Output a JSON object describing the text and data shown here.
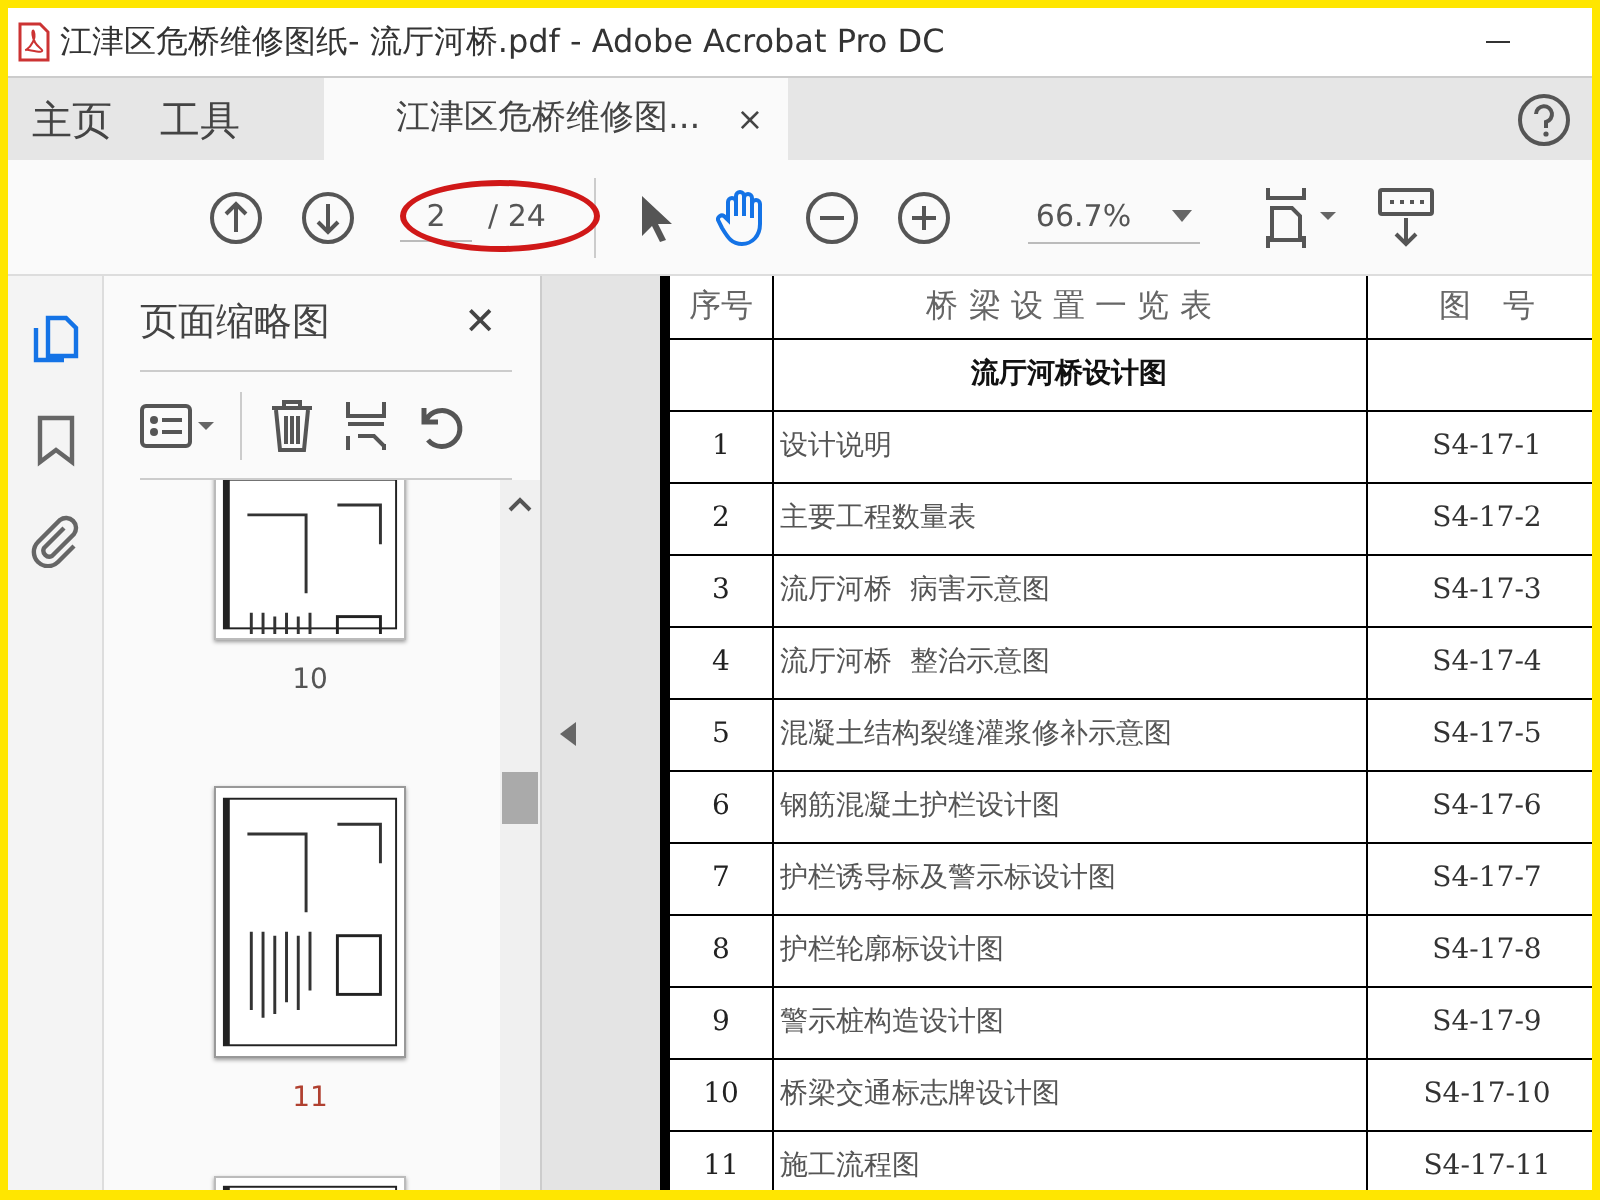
{
  "window": {
    "title": "江津区危桥维修图纸- 流厅河桥.pdf - Adobe Acrobat Pro DC"
  },
  "tabs": [
    {
      "label": "主页",
      "selected": false
    },
    {
      "label": "工具",
      "selected": false
    },
    {
      "label": "江津区危桥维修图...",
      "selected": true,
      "close": "×"
    }
  ],
  "toolbar": {
    "page_number": "2",
    "page_total": "/ 24",
    "zoom": "66.7%",
    "tools": [
      {
        "kind": "pointer",
        "selected": false
      },
      {
        "kind": "hand",
        "selected": true
      }
    ]
  },
  "side_rail": [
    {
      "kind": "pages",
      "selected": true
    },
    {
      "kind": "bookmarks",
      "selected": false
    },
    {
      "kind": "attachments",
      "selected": false
    }
  ],
  "thumbnail_panel": {
    "title": "页面缩略图",
    "close": "✕",
    "thumbnails": [
      {
        "label": "10",
        "selected": false
      },
      {
        "label": "11",
        "selected": true
      },
      {
        "selected": false
      }
    ]
  },
  "table": {
    "columns": [
      "序号",
      "桥 梁 设 置 一 览 表",
      "图　号"
    ],
    "section": "流厅河桥设计图",
    "rows": [
      [
        "1",
        "设计说明",
        "S4-17-1"
      ],
      [
        "2",
        "主要工程数量表",
        "S4-17-2"
      ],
      [
        "3",
        "流厅河桥  病害示意图",
        "S4-17-3"
      ],
      [
        "4",
        "流厅河桥  整治示意图",
        "S4-17-4"
      ],
      [
        "5",
        "混凝土结构裂缝灌浆修补示意图",
        "S4-17-5"
      ],
      [
        "6",
        "钢筋混凝土护栏设计图",
        "S4-17-6"
      ],
      [
        "7",
        "护栏诱导标及警示标设计图",
        "S4-17-7"
      ],
      [
        "8",
        "护栏轮廓标设计图",
        "S4-17-8"
      ],
      [
        "9",
        "警示桩构造设计图",
        "S4-17-9"
      ],
      [
        "10",
        "桥梁交通标志牌设计图",
        "S4-17-10"
      ],
      [
        "11",
        "施工流程图",
        "S4-17-11"
      ]
    ]
  }
}
